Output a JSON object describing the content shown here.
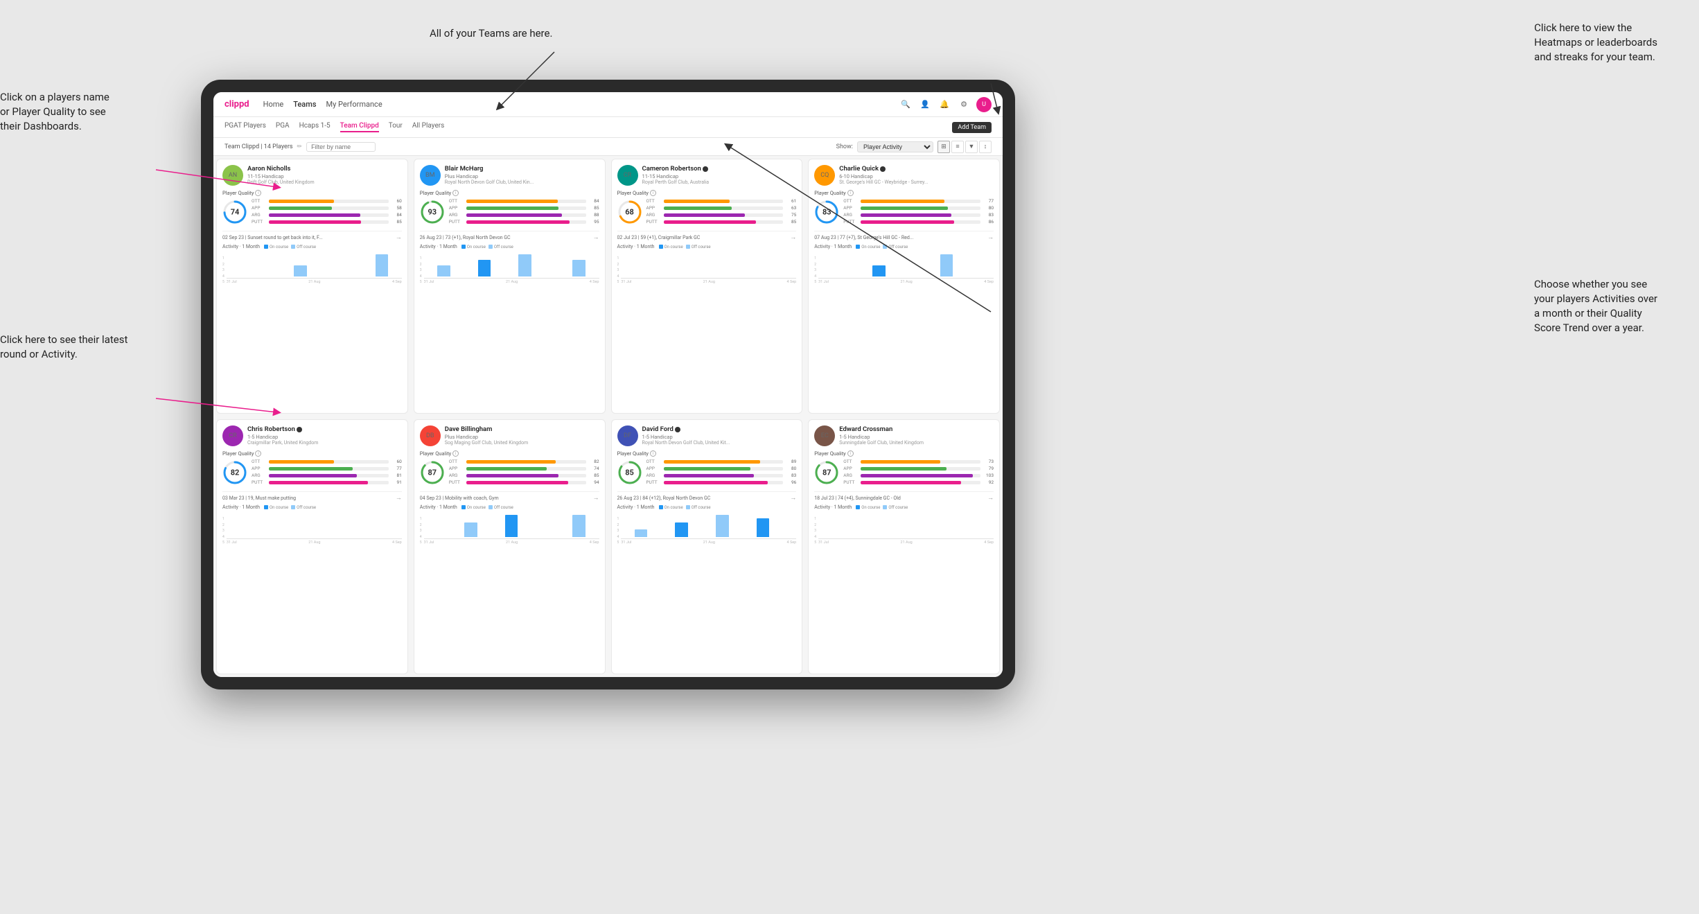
{
  "annotations": {
    "top_center": "All of your Teams are here.",
    "top_right_title": "Click here to view the\nHeatmaps or leaderboards\nand streaks for your team.",
    "left_top_title": "Click on a players name\nor Player Quality to see\ntheir Dashboards.",
    "left_bottom_title": "Click here to see their latest\nround or Activity.",
    "right_bottom_title": "Choose whether you see\nyour players Activities over\na month or their Quality\nScore Trend over a year."
  },
  "nav": {
    "logo": "clippd",
    "links": [
      "Home",
      "Teams",
      "My Performance"
    ],
    "add_team": "Add Team"
  },
  "subnav": {
    "tabs": [
      "PGAT Players",
      "PGA",
      "Hcaps 1-5",
      "Team Clippd",
      "Tour",
      "All Players"
    ]
  },
  "toolbar": {
    "team_label": "Team Clippd | 14 Players",
    "filter_placeholder": "Filter by name",
    "show_label": "Show:",
    "show_value": "Player Activity"
  },
  "players": [
    {
      "name": "Aaron Nicholls",
      "handicap": "11-15 Handicap",
      "club": "Drift Golf Club, United Kingdom",
      "score": 74,
      "score_color": "#2196f3",
      "score_pct": 74,
      "stats": {
        "OTT": {
          "val": 60,
          "color": "#ff9800"
        },
        "APP": {
          "val": 58,
          "color": "#4caf50"
        },
        "ARG": {
          "val": 84,
          "color": "#9c27b0"
        },
        "PUTT": {
          "val": 85,
          "color": "#e91e8c"
        }
      },
      "latest": "02 Sep 23 | Sunset round to get back into it, F...",
      "avatar_color": "avatar-green",
      "avatar_initials": "AN",
      "activity_bars": [
        0,
        0,
        0,
        0,
        0,
        1,
        0,
        0,
        0,
        0,
        0,
        2,
        0
      ]
    },
    {
      "name": "Blair McHarg",
      "handicap": "Plus Handicap",
      "club": "Royal North Devon Golf Club, United Kin...",
      "score": 93,
      "score_color": "#4caf50",
      "score_pct": 93,
      "stats": {
        "OTT": {
          "val": 84,
          "color": "#ff9800"
        },
        "APP": {
          "val": 85,
          "color": "#4caf50"
        },
        "ARG": {
          "val": 88,
          "color": "#9c27b0"
        },
        "PUTT": {
          "val": 95,
          "color": "#e91e8c"
        }
      },
      "latest": "26 Aug 23 | 73 (+1), Royal North Devon GC",
      "avatar_color": "avatar-blue",
      "avatar_initials": "BM",
      "activity_bars": [
        0,
        2,
        0,
        0,
        3,
        0,
        0,
        4,
        0,
        0,
        0,
        3,
        0
      ]
    },
    {
      "name": "Cameron Robertson",
      "handicap": "11-15 Handicap",
      "club": "Royal Perth Golf Club, Australia",
      "score": 68,
      "score_color": "#ff9800",
      "score_pct": 68,
      "stats": {
        "OTT": {
          "val": 61,
          "color": "#ff9800"
        },
        "APP": {
          "val": 63,
          "color": "#4caf50"
        },
        "ARG": {
          "val": 75,
          "color": "#9c27b0"
        },
        "PUTT": {
          "val": 85,
          "color": "#e91e8c"
        }
      },
      "latest": "02 Jul 23 | 59 (+1), Craigmillar Park GC",
      "avatar_color": "avatar-teal",
      "avatar_initials": "CR",
      "activity_bars": [
        0,
        0,
        0,
        0,
        0,
        0,
        0,
        0,
        0,
        0,
        0,
        0,
        0
      ]
    },
    {
      "name": "Charlie Quick",
      "handicap": "6-10 Handicap",
      "club": "St. George's Hill GC - Weybridge - Surrey...",
      "score": 83,
      "score_color": "#2196f3",
      "score_pct": 83,
      "stats": {
        "OTT": {
          "val": 77,
          "color": "#ff9800"
        },
        "APP": {
          "val": 80,
          "color": "#4caf50"
        },
        "ARG": {
          "val": 83,
          "color": "#9c27b0"
        },
        "PUTT": {
          "val": 86,
          "color": "#e91e8c"
        }
      },
      "latest": "07 Aug 23 | 77 (+7), St George's Hill GC - Red...",
      "avatar_color": "avatar-orange",
      "avatar_initials": "CQ",
      "activity_bars": [
        0,
        0,
        0,
        0,
        1,
        0,
        0,
        0,
        0,
        2,
        0,
        0,
        0
      ]
    },
    {
      "name": "Chris Robertson",
      "handicap": "1-5 Handicap",
      "club": "Craigmillar Park, United Kingdom",
      "score": 82,
      "score_color": "#2196f3",
      "score_pct": 82,
      "stats": {
        "OTT": {
          "val": 60,
          "color": "#ff9800"
        },
        "APP": {
          "val": 77,
          "color": "#4caf50"
        },
        "ARG": {
          "val": 81,
          "color": "#9c27b0"
        },
        "PUTT": {
          "val": 91,
          "color": "#e91e8c"
        }
      },
      "latest": "03 Mar 23 | 19, Must make putting",
      "avatar_color": "avatar-purple",
      "avatar_initials": "CR",
      "activity_bars": [
        0,
        0,
        0,
        0,
        0,
        0,
        0,
        0,
        0,
        0,
        0,
        0,
        0
      ]
    },
    {
      "name": "Dave Billingham",
      "handicap": "Plus Handicap",
      "club": "Sog Maging Golf Club, United Kingdom",
      "score": 87,
      "score_color": "#4caf50",
      "score_pct": 87,
      "stats": {
        "OTT": {
          "val": 82,
          "color": "#ff9800"
        },
        "APP": {
          "val": 74,
          "color": "#4caf50"
        },
        "ARG": {
          "val": 85,
          "color": "#9c27b0"
        },
        "PUTT": {
          "val": 94,
          "color": "#e91e8c"
        }
      },
      "latest": "04 Sep 23 | Mobility with coach, Gym",
      "avatar_color": "avatar-red",
      "avatar_initials": "DB",
      "activity_bars": [
        0,
        0,
        0,
        2,
        0,
        0,
        3,
        0,
        0,
        0,
        0,
        3,
        0
      ]
    },
    {
      "name": "David Ford",
      "handicap": "1-5 Handicap",
      "club": "Royal North Devon Golf Club, United Kit...",
      "score": 85,
      "score_color": "#4caf50",
      "score_pct": 85,
      "stats": {
        "OTT": {
          "val": 89,
          "color": "#ff9800"
        },
        "APP": {
          "val": 80,
          "color": "#4caf50"
        },
        "ARG": {
          "val": 83,
          "color": "#9c27b0"
        },
        "PUTT": {
          "val": 96,
          "color": "#e91e8c"
        }
      },
      "latest": "26 Aug 23 | 84 (+12), Royal North Devon GC",
      "avatar_color": "avatar-indigo",
      "avatar_initials": "DF",
      "activity_bars": [
        0,
        2,
        0,
        0,
        4,
        0,
        0,
        6,
        0,
        0,
        5,
        0,
        0
      ]
    },
    {
      "name": "Edward Crossman",
      "handicap": "1-5 Handicap",
      "club": "Sunningdale Golf Club, United Kingdom",
      "score": 87,
      "score_color": "#4caf50",
      "score_pct": 87,
      "stats": {
        "OTT": {
          "val": 73,
          "color": "#ff9800"
        },
        "APP": {
          "val": 79,
          "color": "#4caf50"
        },
        "ARG": {
          "val": 103,
          "color": "#9c27b0"
        },
        "PUTT": {
          "val": 92,
          "color": "#e91e8c"
        }
      },
      "latest": "18 Jul 23 | 74 (+4), Sunningdale GC - Old",
      "avatar_color": "avatar-brown",
      "avatar_initials": "EC",
      "activity_bars": [
        0,
        0,
        0,
        0,
        0,
        0,
        0,
        0,
        0,
        0,
        0,
        0,
        0
      ]
    }
  ]
}
